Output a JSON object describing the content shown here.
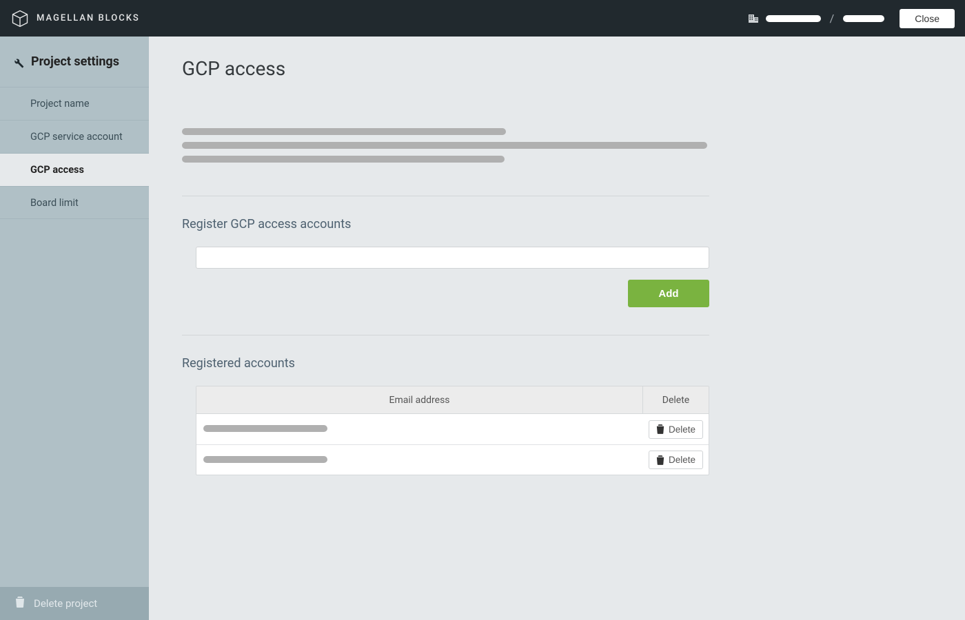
{
  "brand": "MAGELLAN BLOCKS",
  "header": {
    "close_label": "Close",
    "breadcrumb_separator": "/"
  },
  "sidebar": {
    "title": "Project settings",
    "items": [
      {
        "label": "Project name",
        "active": false
      },
      {
        "label": "GCP service account",
        "active": false
      },
      {
        "label": "GCP access",
        "active": true
      },
      {
        "label": "Board limit",
        "active": false
      }
    ],
    "delete_project_label": "Delete project"
  },
  "main": {
    "title": "GCP access",
    "register_heading": "Register GCP access accounts",
    "add_button_label": "Add",
    "registered_heading": "Registered accounts",
    "table": {
      "columns": {
        "email": "Email address",
        "delete": "Delete"
      },
      "rows": [
        {
          "email_placeholder": true,
          "delete_label": "Delete"
        },
        {
          "email_placeholder": true,
          "delete_label": "Delete"
        }
      ]
    }
  }
}
